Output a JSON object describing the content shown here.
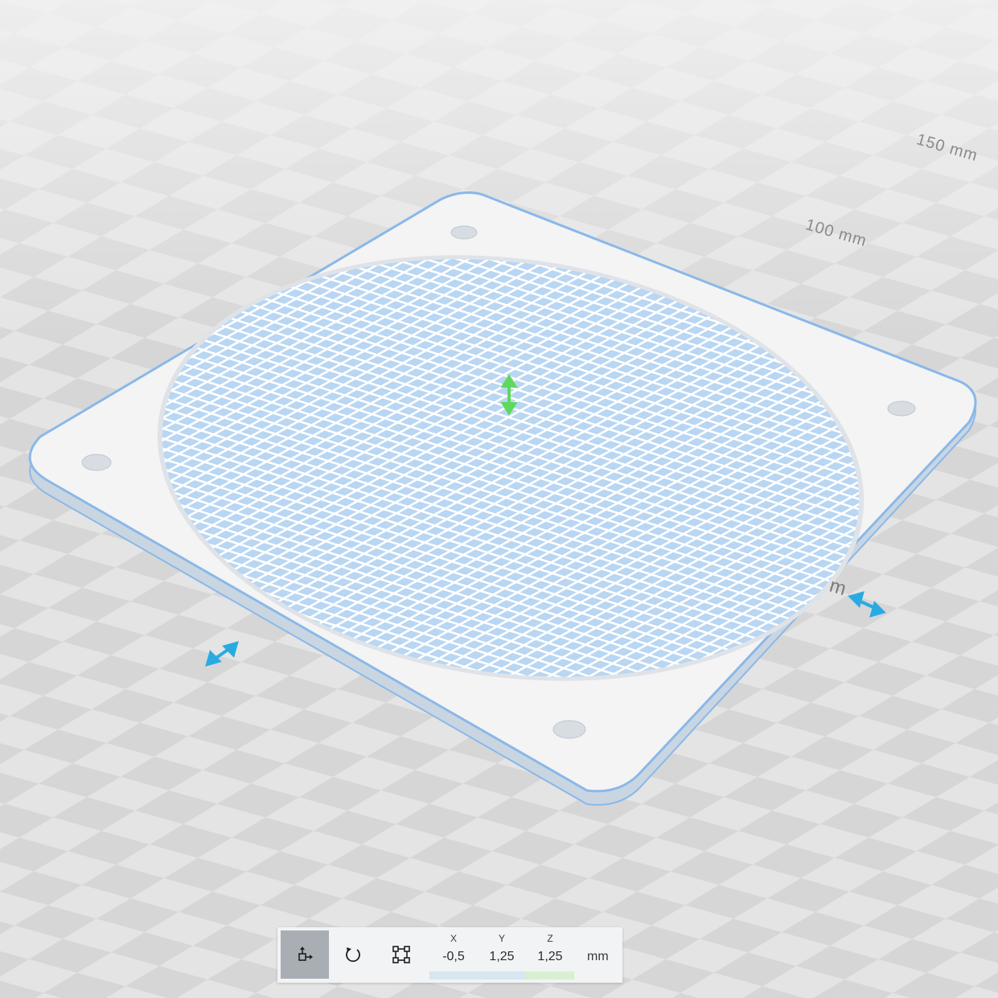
{
  "viewport": {
    "ruler_labels": [
      "150 mm",
      "100 mm",
      "m"
    ]
  },
  "toolbar": {
    "tools": [
      {
        "name": "move-tool",
        "icon": "move-icon",
        "active": true
      },
      {
        "name": "rotate-tool",
        "icon": "rotate-icon",
        "active": false
      },
      {
        "name": "scale-tool",
        "icon": "scale-icon",
        "active": false
      }
    ],
    "x_label": "X",
    "y_label": "Y",
    "z_label": "Z",
    "x_value": "-0,5",
    "y_value": "1,25",
    "z_value": "1,25",
    "unit": "mm"
  },
  "colors": {
    "accent_blue": "#29abe2",
    "gizmo_green": "#5fd85f",
    "selection_outline": "#8ab8e8"
  }
}
